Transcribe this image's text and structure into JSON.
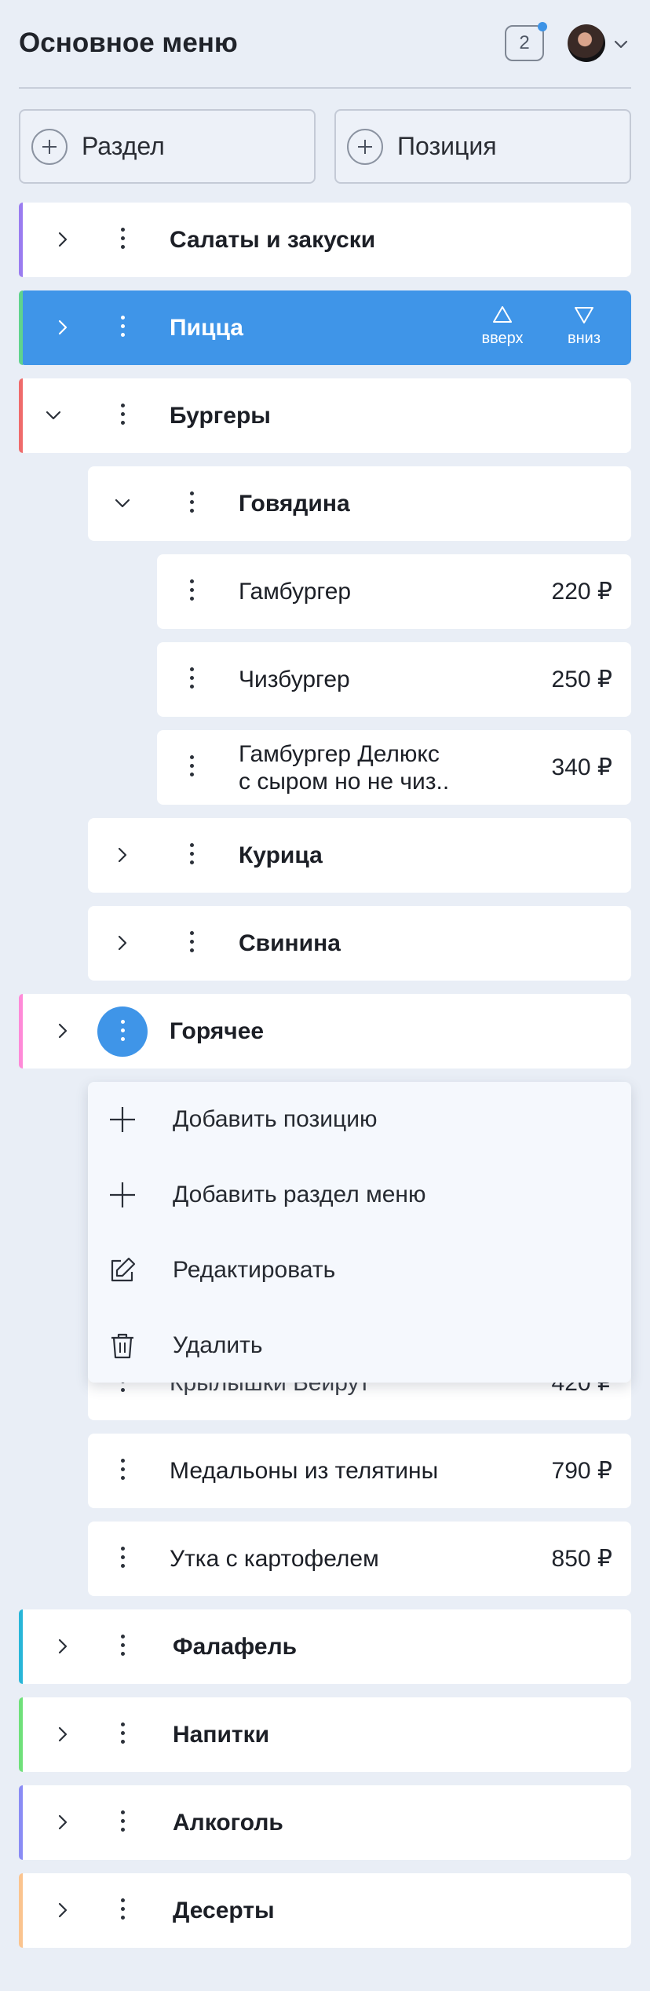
{
  "header": {
    "title": "Основное меню",
    "notifications_count": "2",
    "accent_color": "#3f95e8"
  },
  "actions": {
    "add_section": "Раздел",
    "add_item": "Позиция"
  },
  "sections": {
    "salads": {
      "label": "Салаты и закуски",
      "stripe": "#9a7cf0"
    },
    "pizza": {
      "label": "Пицца",
      "stripe": "#5fd38d",
      "move_up": "вверх",
      "move_down": "вниз"
    },
    "burgers": {
      "label": "Бургеры",
      "stripe": "#ef6b6b"
    },
    "hot": {
      "label": "Горячее",
      "stripe": "#ff8ad8"
    },
    "falafel": {
      "label": "Фалафель",
      "stripe": "#28b6d8"
    },
    "drinks": {
      "label": "Напитки",
      "stripe": "#6fe07a"
    },
    "alcohol": {
      "label": "Алкоголь",
      "stripe": "#8a8cf5"
    },
    "desserts": {
      "label": "Десерты",
      "stripe": "#fbc48f"
    }
  },
  "burgers_sub": {
    "beef": {
      "label": "Говядина"
    },
    "chicken": {
      "label": "Курица"
    },
    "pork": {
      "label": "Свинина"
    }
  },
  "beef_items": [
    {
      "name": "Гамбургер",
      "price": "220 ₽"
    },
    {
      "name": "Чизбургер",
      "price": "250 ₽"
    },
    {
      "name_line1": "Гамбургер Делюкс",
      "name_line2": "с сыром но не чиз..",
      "price": "340 ₽"
    }
  ],
  "hot_items": [
    {
      "name": "Крылышки Бейрут",
      "price": "420 ₽"
    },
    {
      "name": "Медальоны из телятины",
      "price": "790 ₽"
    },
    {
      "name": "Утка с картофелем",
      "price": "850 ₽"
    }
  ],
  "context_menu": {
    "add_item": "Добавить позицию",
    "add_section": "Добавить раздел меню",
    "edit": "Редактировать",
    "delete": "Удалить",
    "icons": [
      "plus-icon",
      "plus-icon",
      "edit-icon",
      "trash-icon"
    ]
  }
}
